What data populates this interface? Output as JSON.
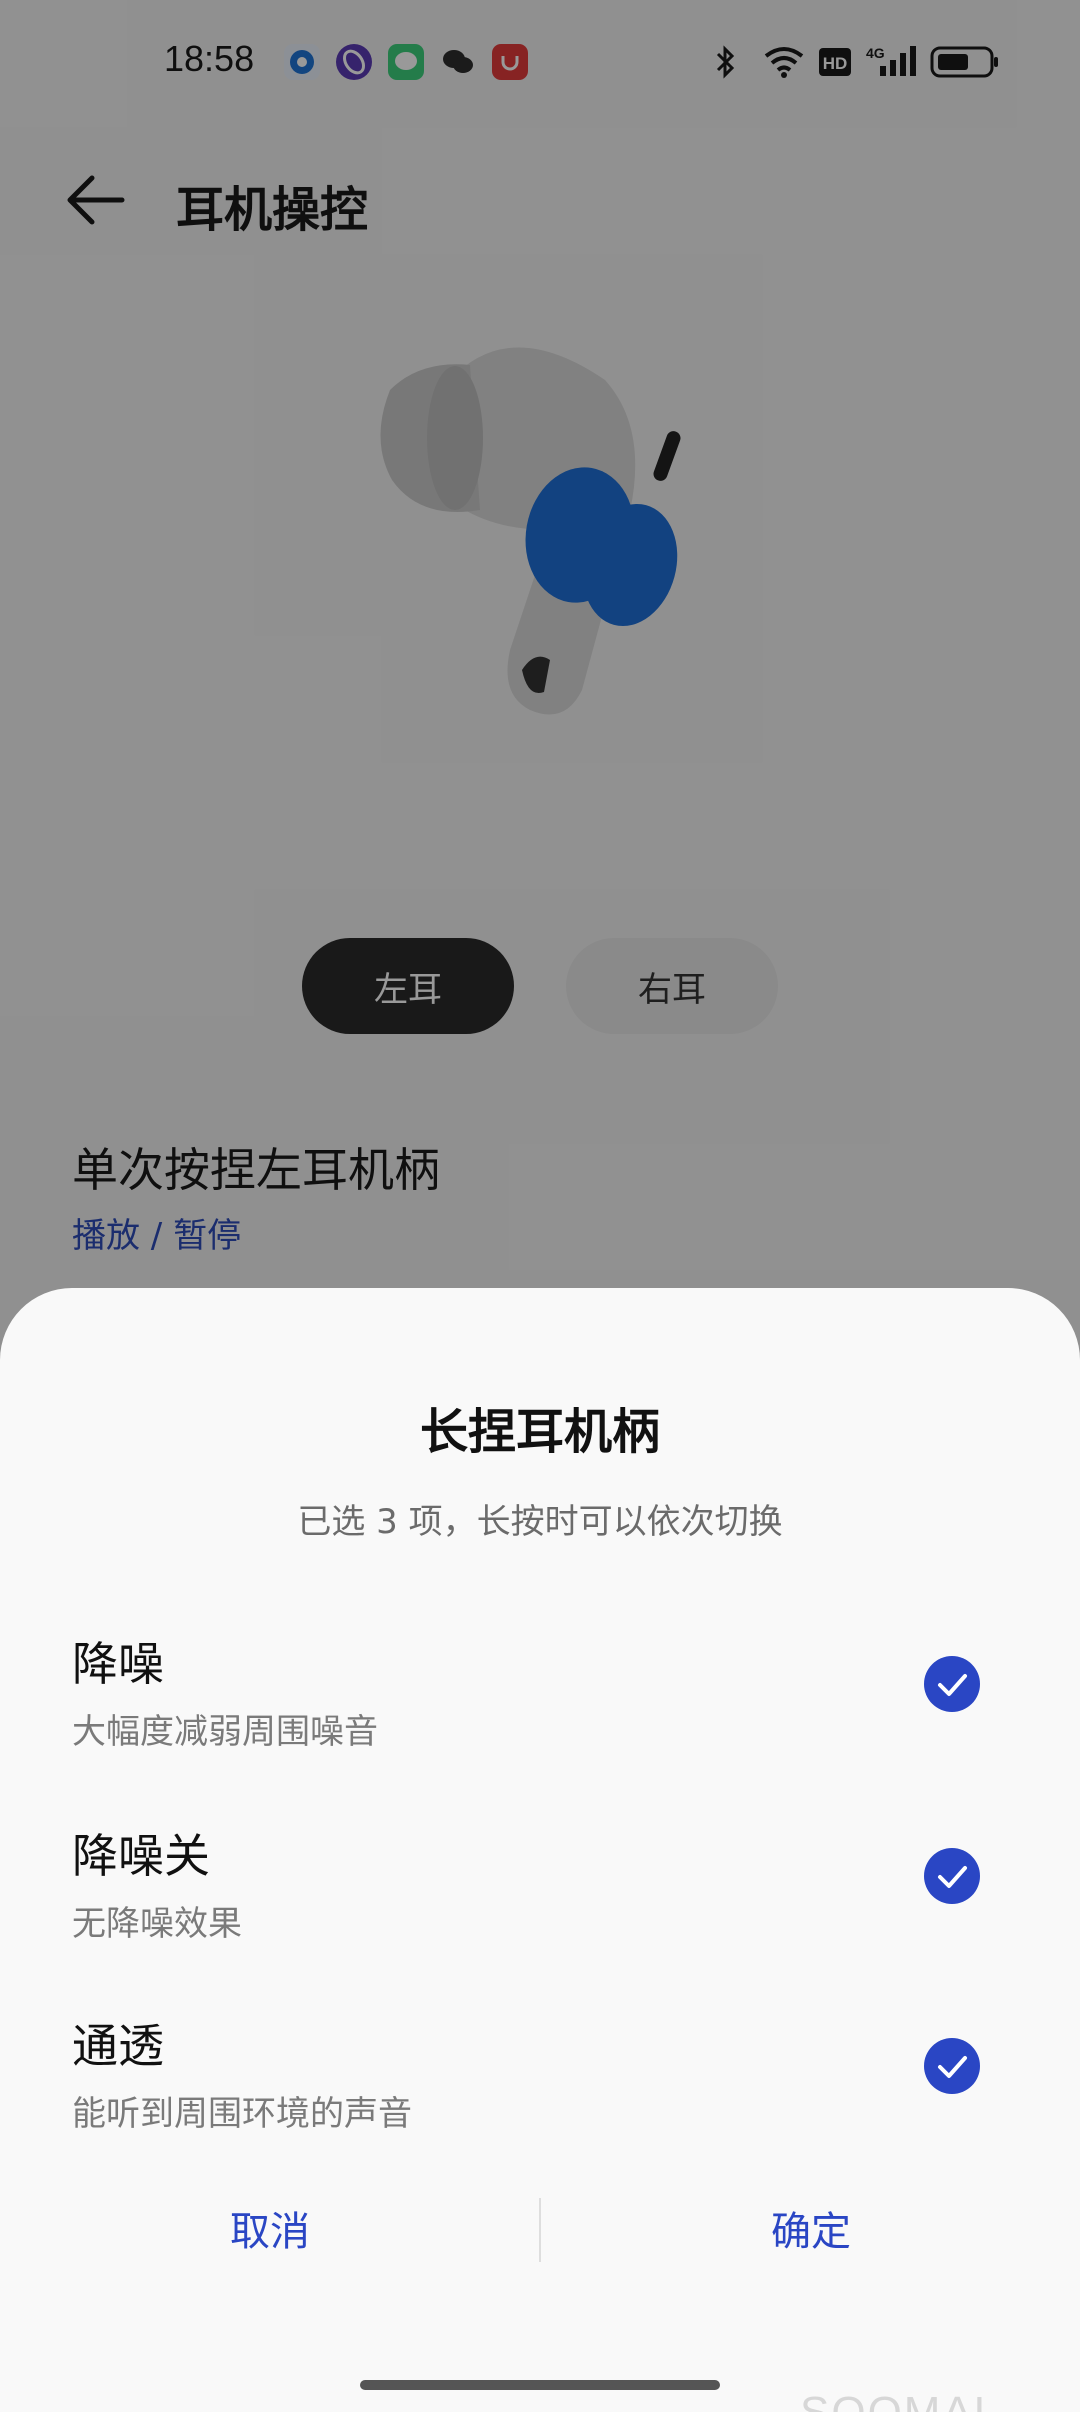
{
  "status_bar": {
    "time": "18:58",
    "app_icons": [
      "browser-icon",
      "assistant-icon",
      "messages-icon",
      "wechat-icon",
      "store-icon"
    ],
    "system_icons": [
      "bluetooth-icon",
      "wifi-icon",
      "hd-icon",
      "signal-4g-icon",
      "battery-icon"
    ],
    "network_label": "4G",
    "hd_label": "HD"
  },
  "header": {
    "title": "耳机操控"
  },
  "ear_selector": {
    "left_label": "左耳",
    "right_label": "右耳",
    "selected": "left"
  },
  "setting": {
    "title": "单次按捏左耳机柄",
    "value": "播放 / 暂停"
  },
  "sheet": {
    "title": "长捏耳机柄",
    "subtitle": "已选 3 项，长按时可以依次切换",
    "options": [
      {
        "title": "降噪",
        "desc": "大幅度减弱周围噪音",
        "checked": true
      },
      {
        "title": "降噪关",
        "desc": "无降噪效果",
        "checked": true
      },
      {
        "title": "通透",
        "desc": "能听到周围环境的声音",
        "checked": true
      }
    ],
    "cancel_label": "取消",
    "confirm_label": "确定"
  },
  "watermark": "SOOMAL",
  "colors": {
    "accent": "#2a46c4",
    "selected_pill": "#2b2b2b",
    "earbud_highlight": "#1f6fd6"
  }
}
